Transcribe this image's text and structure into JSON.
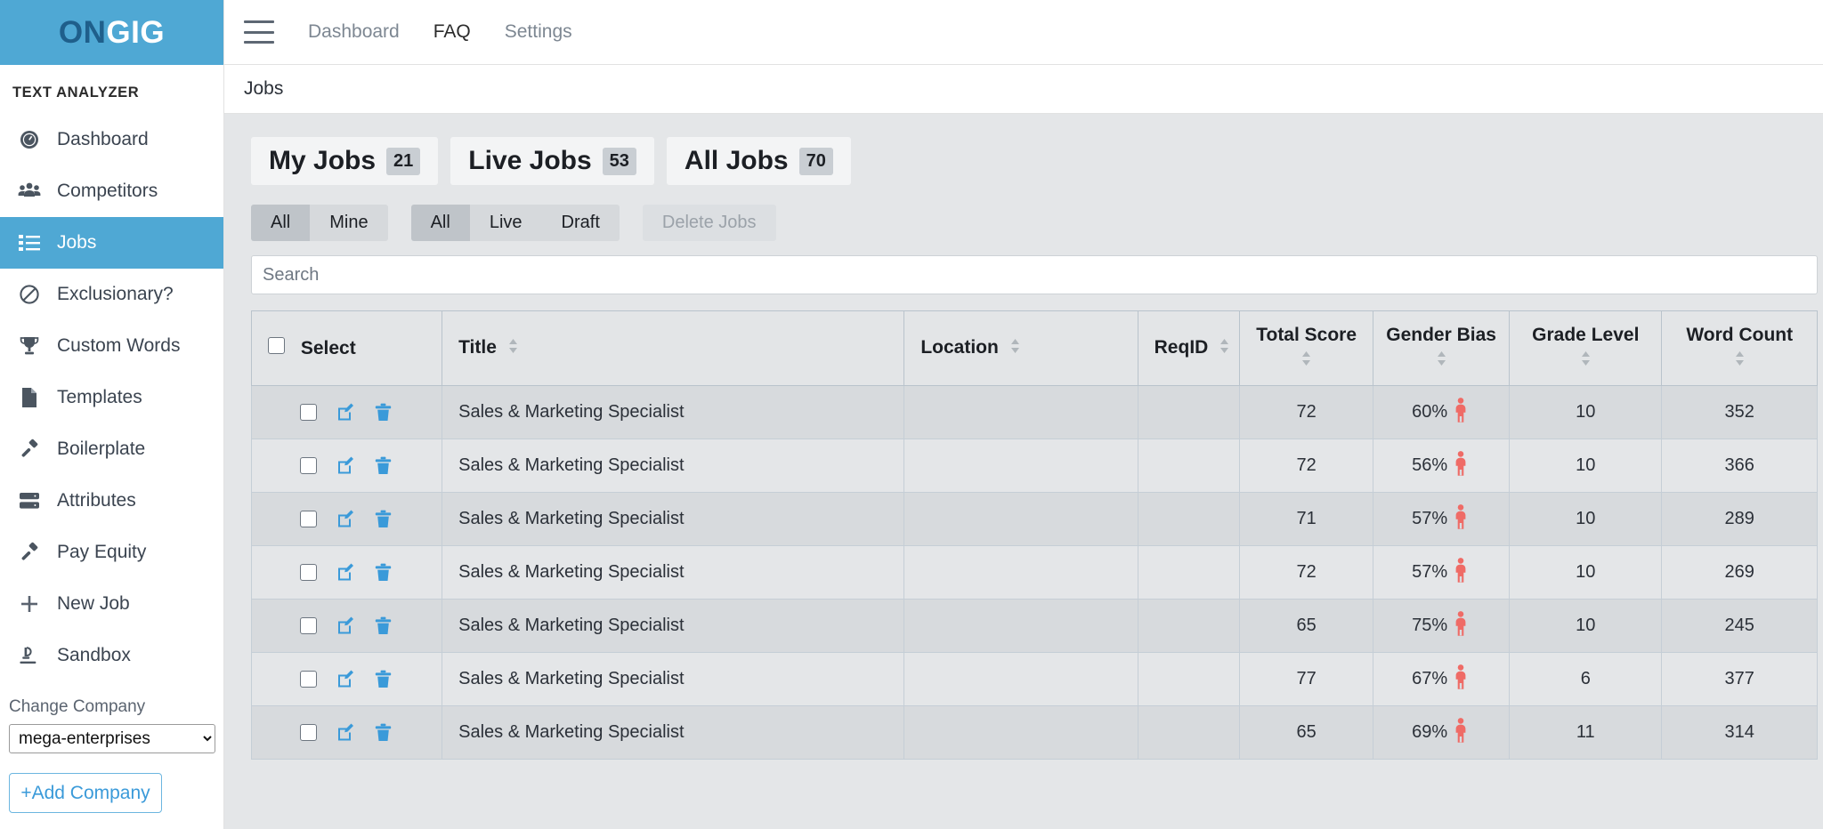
{
  "brand": {
    "part1": "ON",
    "part2": "GIG"
  },
  "sidebar": {
    "section_title": "TEXT ANALYZER",
    "items": [
      {
        "label": "Dashboard",
        "icon": "dashboard-icon",
        "active": false
      },
      {
        "label": "Competitors",
        "icon": "people-icon",
        "active": false
      },
      {
        "label": "Jobs",
        "icon": "list-icon",
        "active": true
      },
      {
        "label": "Exclusionary?",
        "icon": "ban-icon",
        "active": false
      },
      {
        "label": "Custom Words",
        "icon": "trophy-icon",
        "active": false
      },
      {
        "label": "Templates",
        "icon": "document-icon",
        "active": false
      },
      {
        "label": "Boilerplate",
        "icon": "hammer-icon",
        "active": false
      },
      {
        "label": "Attributes",
        "icon": "server-icon",
        "active": false
      },
      {
        "label": "Pay Equity",
        "icon": "gavel-icon",
        "active": false
      },
      {
        "label": "New Job",
        "icon": "plus-icon",
        "active": false
      },
      {
        "label": "Sandbox",
        "icon": "microscope-icon",
        "active": false
      }
    ],
    "change_company_label": "Change Company",
    "company_selected": "mega-enterprises",
    "company_options": [
      "mega-enterprises"
    ],
    "add_company_label": "+Add Company"
  },
  "topbar": {
    "menu_icon": "hamburger-icon",
    "links": [
      {
        "label": "Dashboard",
        "emphasis": "muted"
      },
      {
        "label": "FAQ",
        "emphasis": "dark"
      },
      {
        "label": "Settings",
        "emphasis": "muted"
      }
    ]
  },
  "breadcrumb": {
    "text": "Jobs"
  },
  "tabs": [
    {
      "label": "My Jobs",
      "count": "21"
    },
    {
      "label": "Live Jobs",
      "count": "53"
    },
    {
      "label": "All Jobs",
      "count": "70"
    }
  ],
  "filters": {
    "owner_group": [
      {
        "label": "All",
        "active": true
      },
      {
        "label": "Mine",
        "active": false
      }
    ],
    "status_group": [
      {
        "label": "All",
        "active": true
      },
      {
        "label": "Live",
        "active": false
      },
      {
        "label": "Draft",
        "active": false
      }
    ],
    "delete_label": "Delete Jobs"
  },
  "search": {
    "placeholder": "Search",
    "value": ""
  },
  "table": {
    "columns": [
      {
        "key": "select",
        "label": "Select",
        "sortable": false,
        "stacked": false
      },
      {
        "key": "title",
        "label": "Title",
        "sortable": true,
        "stacked": false
      },
      {
        "key": "location",
        "label": "Location",
        "sortable": true,
        "stacked": false
      },
      {
        "key": "reqid",
        "label": "ReqID",
        "sortable": true,
        "stacked": false
      },
      {
        "key": "total_score",
        "label": "Total Score",
        "sortable": true,
        "stacked": true
      },
      {
        "key": "gender_bias",
        "label": "Gender Bias",
        "sortable": true,
        "stacked": true
      },
      {
        "key": "grade_level",
        "label": "Grade Level",
        "sortable": true,
        "stacked": true
      },
      {
        "key": "word_count",
        "label": "Word Count",
        "sortable": true,
        "stacked": true
      }
    ],
    "rows": [
      {
        "title": "Sales & Marketing Specialist",
        "location": "",
        "reqid": "",
        "total_score": "72",
        "gender_bias": "60%",
        "gender_icon": "male-figure-icon",
        "grade_level": "10",
        "word_count": "352"
      },
      {
        "title": "Sales & Marketing Specialist",
        "location": "",
        "reqid": "",
        "total_score": "72",
        "gender_bias": "56%",
        "gender_icon": "male-figure-icon",
        "grade_level": "10",
        "word_count": "366"
      },
      {
        "title": "Sales & Marketing Specialist",
        "location": "",
        "reqid": "",
        "total_score": "71",
        "gender_bias": "57%",
        "gender_icon": "male-figure-icon",
        "grade_level": "10",
        "word_count": "289"
      },
      {
        "title": "Sales & Marketing Specialist",
        "location": "",
        "reqid": "",
        "total_score": "72",
        "gender_bias": "57%",
        "gender_icon": "male-figure-icon",
        "grade_level": "10",
        "word_count": "269"
      },
      {
        "title": "Sales & Marketing Specialist",
        "location": "",
        "reqid": "",
        "total_score": "65",
        "gender_bias": "75%",
        "gender_icon": "male-figure-icon",
        "grade_level": "10",
        "word_count": "245"
      },
      {
        "title": "Sales & Marketing Specialist",
        "location": "",
        "reqid": "",
        "total_score": "77",
        "gender_bias": "67%",
        "gender_icon": "male-figure-icon",
        "grade_level": "6",
        "word_count": "377"
      },
      {
        "title": "Sales & Marketing Specialist",
        "location": "",
        "reqid": "",
        "total_score": "65",
        "gender_bias": "69%",
        "gender_icon": "male-figure-icon",
        "grade_level": "11",
        "word_count": "314"
      }
    ],
    "row_action_icons": [
      "row-checkbox",
      "edit-icon",
      "delete-icon"
    ]
  },
  "colors": {
    "brand_blue": "#4FA8D4",
    "brand_dark_blue": "#1F5F8B",
    "accent_link": "#3a9ad9",
    "gender_red": "#ef6b66",
    "content_bg": "#e4e6e8"
  }
}
